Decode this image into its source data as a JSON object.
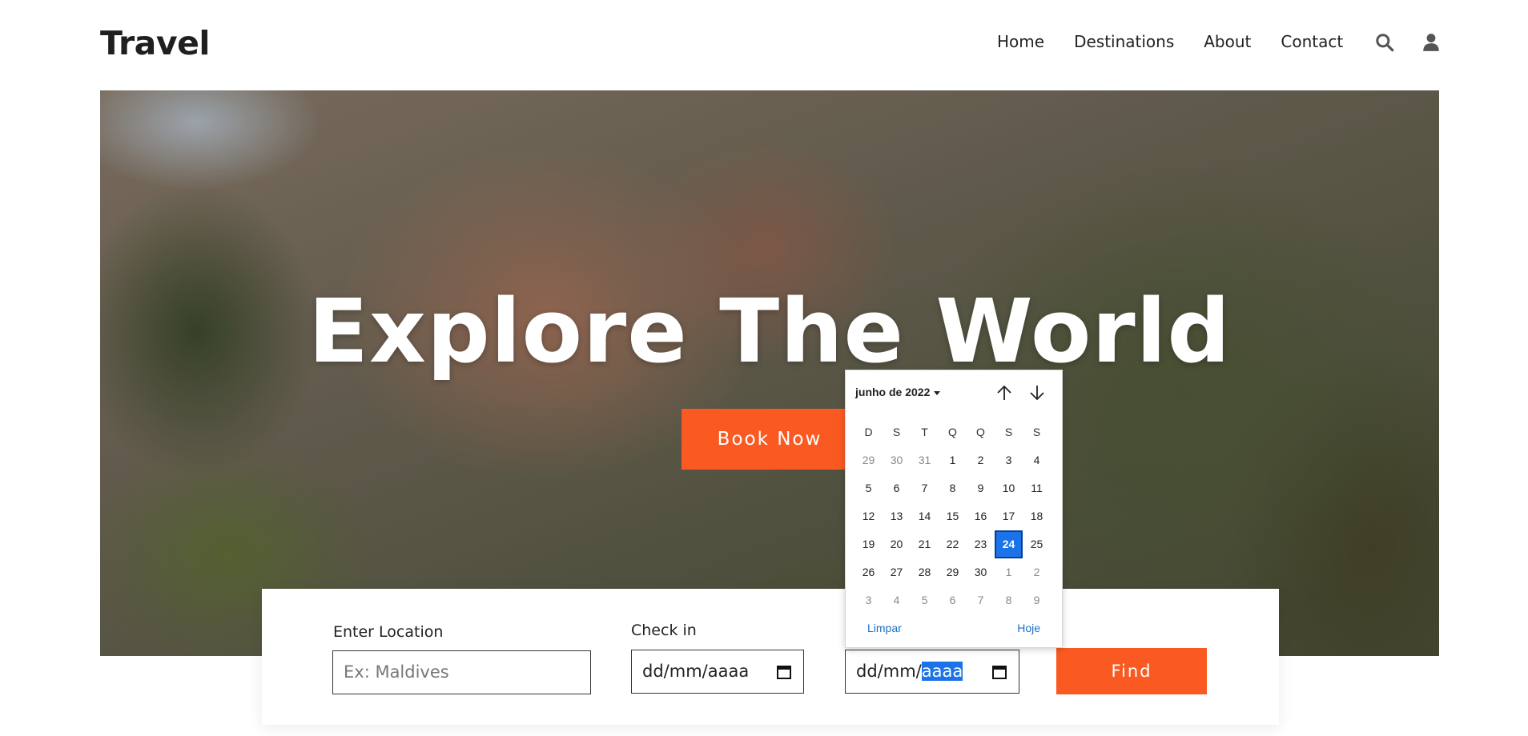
{
  "header": {
    "logo": "Travel",
    "nav": [
      "Home",
      "Destinations",
      "About",
      "Contact"
    ],
    "icons": [
      "search-icon",
      "user-icon"
    ]
  },
  "hero": {
    "title": "Explore The World",
    "cta": "Book Now"
  },
  "search": {
    "location_label": "Enter Location",
    "location_placeholder": "Ex: Maldives",
    "checkin_label": "Check in",
    "checkin_value": "dd/mm/aaaa",
    "checkout_prefix": "dd/mm/",
    "checkout_selected": "aaaa",
    "find_label": "Find"
  },
  "calendar": {
    "month_label": "junho de 2022",
    "weekdays": [
      "D",
      "S",
      "T",
      "Q",
      "Q",
      "S",
      "S"
    ],
    "days": [
      {
        "d": "29",
        "dim": true
      },
      {
        "d": "30",
        "dim": true
      },
      {
        "d": "31",
        "dim": true
      },
      {
        "d": "1"
      },
      {
        "d": "2"
      },
      {
        "d": "3"
      },
      {
        "d": "4"
      },
      {
        "d": "5"
      },
      {
        "d": "6"
      },
      {
        "d": "7"
      },
      {
        "d": "8"
      },
      {
        "d": "9"
      },
      {
        "d": "10"
      },
      {
        "d": "11"
      },
      {
        "d": "12"
      },
      {
        "d": "13"
      },
      {
        "d": "14"
      },
      {
        "d": "15"
      },
      {
        "d": "16"
      },
      {
        "d": "17"
      },
      {
        "d": "18"
      },
      {
        "d": "19"
      },
      {
        "d": "20"
      },
      {
        "d": "21"
      },
      {
        "d": "22"
      },
      {
        "d": "23"
      },
      {
        "d": "24",
        "selected": true
      },
      {
        "d": "25"
      },
      {
        "d": "26"
      },
      {
        "d": "27"
      },
      {
        "d": "28"
      },
      {
        "d": "29"
      },
      {
        "d": "30"
      },
      {
        "d": "1",
        "dim": true
      },
      {
        "d": "2",
        "dim": true
      },
      {
        "d": "3",
        "dim": true
      },
      {
        "d": "4",
        "dim": true
      },
      {
        "d": "5",
        "dim": true
      },
      {
        "d": "6",
        "dim": true
      },
      {
        "d": "7",
        "dim": true
      },
      {
        "d": "8",
        "dim": true
      },
      {
        "d": "9",
        "dim": true
      }
    ],
    "clear_label": "Limpar",
    "today_label": "Hoje"
  },
  "colors": {
    "accent": "#fa5a22",
    "selection": "#1a73e8"
  }
}
